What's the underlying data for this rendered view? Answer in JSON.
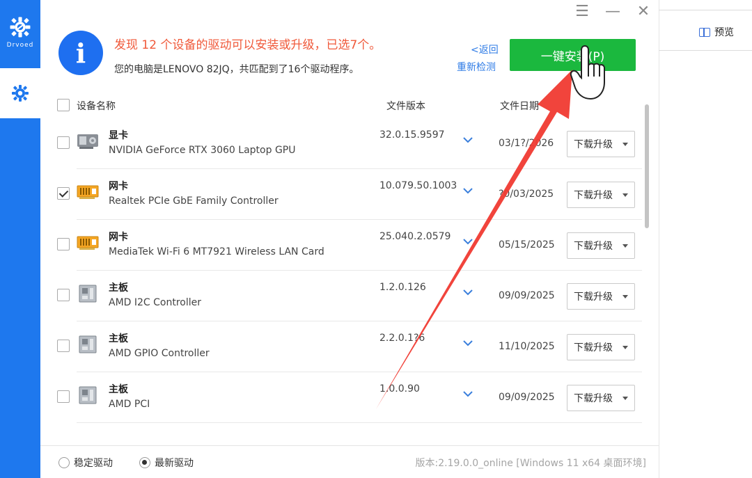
{
  "sidebar": {
    "logo_text": "Drvoed",
    "settings_icon": "gear-icon"
  },
  "window_controls": {
    "menu": "☰",
    "minimize": "—",
    "close": "✕"
  },
  "header": {
    "headline": "发现 12 个设备的驱动可以安装或升级，已选7个。",
    "subline": "您的电脑是LENOVO 82JQ，共匹配到了16个驱动程序。",
    "back_label": "<返回",
    "recheck_label": "重新检测",
    "install_label": "一键安装(P)"
  },
  "table": {
    "col_name": "设备名称",
    "col_version": "文件版本",
    "col_date": "文件日期",
    "rows": [
      {
        "category": "显卡",
        "name": "NVIDIA GeForce RTX 3060 Laptop GPU",
        "version": "32.0.15.9597",
        "date": "03/1?/2026",
        "action": "下载升级",
        "checked": false,
        "icon": "gpu-icon"
      },
      {
        "category": "网卡",
        "name": "Realtek PCIe GbE Family Controller",
        "version": "10.079.50.1003",
        "date": "?0/03/2025",
        "action": "下载升级",
        "checked": true,
        "icon": "network-card-icon"
      },
      {
        "category": "网卡",
        "name": "MediaTek Wi-Fi 6 MT7921 Wireless LAN Card",
        "version": "25.040.2.0579",
        "date": "05/15/2025",
        "action": "下载升级",
        "checked": false,
        "icon": "network-card-icon"
      },
      {
        "category": "主板",
        "name": "AMD I2C Controller",
        "version": "1.2.0.126",
        "date": "09/09/2025",
        "action": "下载升级",
        "checked": false,
        "icon": "motherboard-icon"
      },
      {
        "category": "主板",
        "name": "AMD GPIO Controller",
        "version": "2.2.0.1?6",
        "date": "11/10/2025",
        "action": "下载升级",
        "checked": false,
        "icon": "motherboard-icon"
      },
      {
        "category": "主板",
        "name": "AMD PCI",
        "version": "1.0.0.90",
        "date": "09/09/2025",
        "action": "下载升级",
        "checked": false,
        "icon": "motherboard-icon"
      }
    ]
  },
  "footer": {
    "option_stable": "稳定驱动",
    "option_latest": "最新驱动",
    "selected": "latest",
    "version_text": "版本:2.19.0.0_online [Windows 11 x64 桌面环境]"
  },
  "outside": {
    "preview_label": "预览"
  },
  "colors": {
    "sidebar_blue": "#1e78ee",
    "headline_orange": "#f0593a",
    "install_green": "#1bb83e",
    "link_blue": "#2e7be6",
    "arrow_red": "#f03a32"
  }
}
